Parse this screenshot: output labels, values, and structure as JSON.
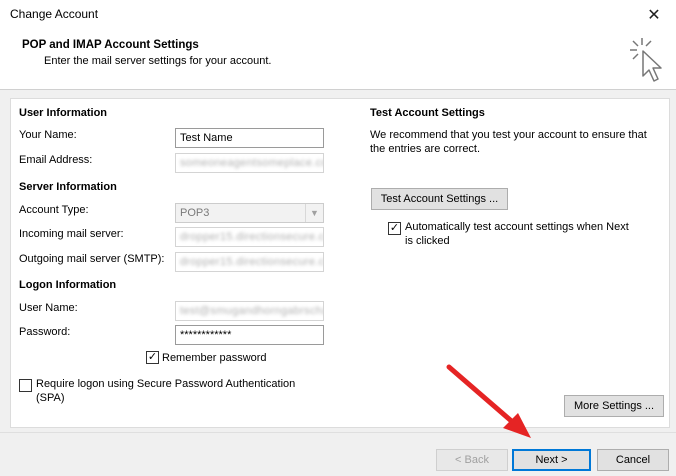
{
  "window": {
    "title": "Change Account"
  },
  "header": {
    "title": "POP and IMAP Account Settings",
    "subtitle": "Enter the mail server settings for your account."
  },
  "user_info": {
    "section": "User Information",
    "name_label": "Your Name:",
    "name_value": "Test Name",
    "email_label": "Email Address:",
    "email_value": "someoneagentsomeplace.com"
  },
  "server_info": {
    "section": "Server Information",
    "account_type_label": "Account Type:",
    "account_type_value": "POP3",
    "incoming_label": "Incoming mail server:",
    "incoming_value": "dropper15.directionsecure.co",
    "outgoing_label": "Outgoing mail server (SMTP):",
    "outgoing_value": "dropper15.directionsecure.co"
  },
  "logon_info": {
    "section": "Logon Information",
    "username_label": "User Name:",
    "username_value": "test@smugandhorngabrscham.",
    "password_label": "Password:",
    "password_value": "************",
    "remember_label": "Remember password",
    "remember_checked": true,
    "spa_label_line1": "Require logon using Secure Password Authentication",
    "spa_label_line2": "(SPA)",
    "spa_checked": false
  },
  "test_settings": {
    "section": "Test Account Settings",
    "desc_line1": "We recommend that you test your account to ensure that",
    "desc_line2": "the entries are correct.",
    "button": "Test Account Settings ...",
    "auto_test_line1": "Automatically test account settings when Next",
    "auto_test_line2": "is clicked",
    "auto_test_checked": true
  },
  "more_settings_button": "More Settings ...",
  "footer": {
    "back": "< Back",
    "next": "Next >",
    "cancel": "Cancel"
  },
  "icons": {
    "close": "close-icon",
    "header": "mouse-pointer-click-icon",
    "check": "✓",
    "dropdown": "chevron-down-icon"
  },
  "colors": {
    "annotation_arrow": "#e52424",
    "focus_border": "#0078d7"
  }
}
